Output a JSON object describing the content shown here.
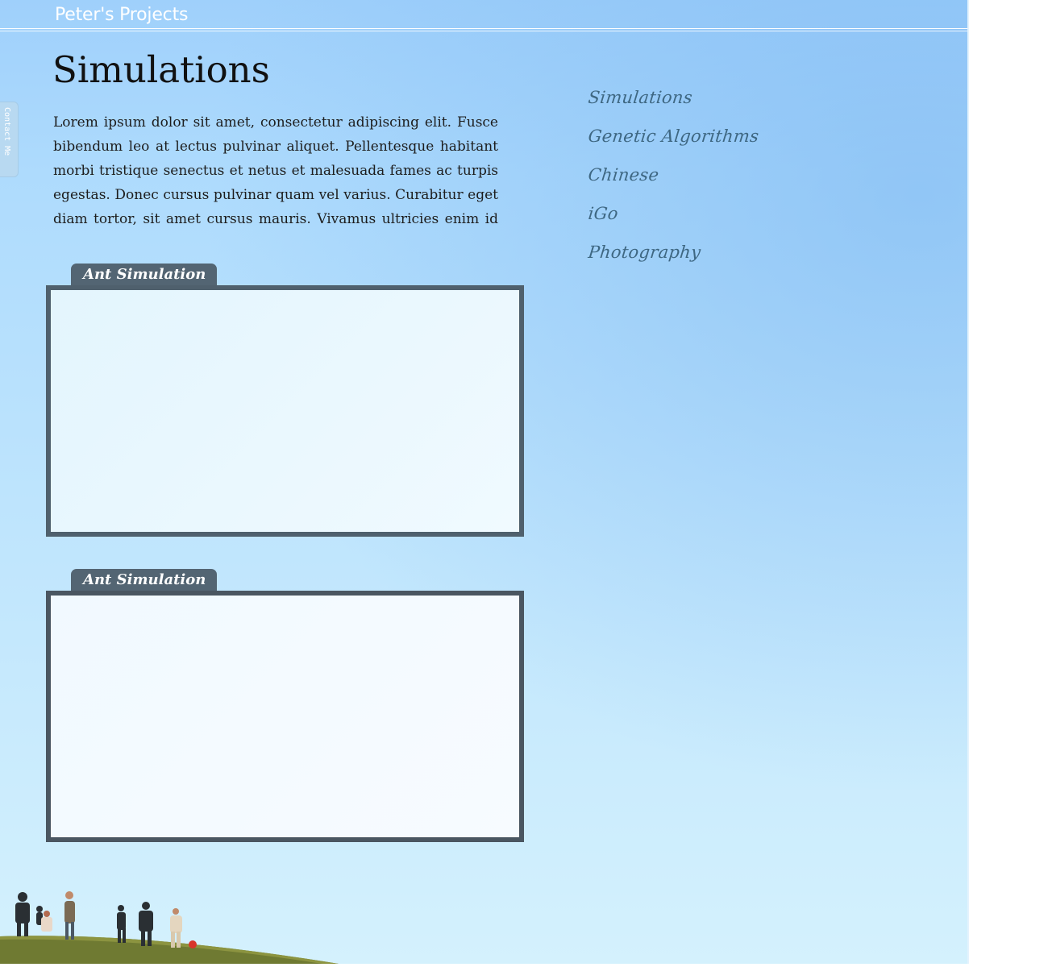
{
  "header": {
    "site_title": "Peter's Projects"
  },
  "contact_tab": {
    "label": "Contact Me"
  },
  "main": {
    "title": "Simulations",
    "intro": "Lorem ipsum dolor sit amet, consectetur adipiscing elit. Fusce bibendum leo at lectus pulvinar aliquet. Pellentesque habitant morbi tristique senectus et netus et malesuada fames ac turpis egestas. Donec cursus pulvinar quam vel varius. Curabitur eget diam tortor, sit amet cursus mauris. Vivamus ultricies enim id massa suscipit.",
    "panels": [
      {
        "title": "Ant Simulation"
      },
      {
        "title": "Ant Simulation"
      }
    ]
  },
  "nav": {
    "items": [
      {
        "label": "Simulations"
      },
      {
        "label": "Genetic Algorithms"
      },
      {
        "label": "Chinese"
      },
      {
        "label": "iGo"
      },
      {
        "label": "Photography"
      }
    ]
  },
  "colors": {
    "sky_top": "#9fd0fb",
    "sky_bottom": "#d4f1fd",
    "panel_frame": "#4f606d",
    "nav_ink": "#3e6782"
  }
}
